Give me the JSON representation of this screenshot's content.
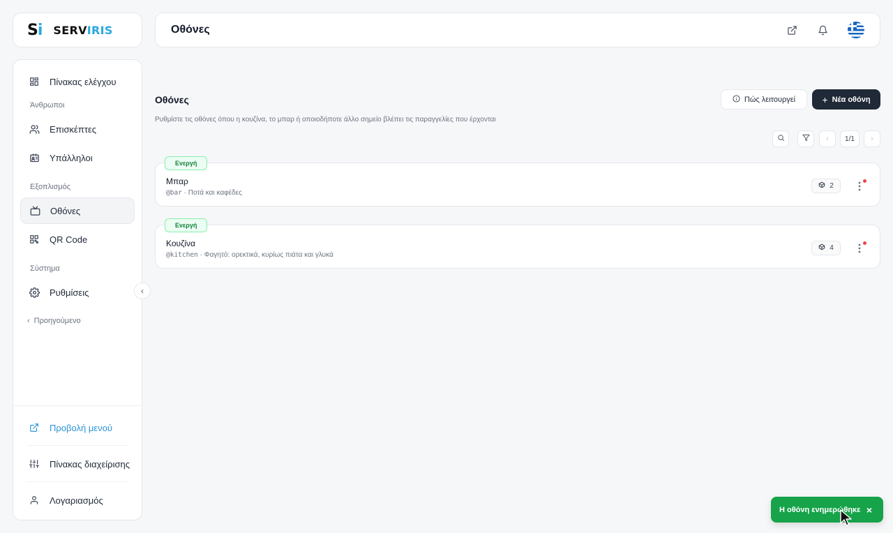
{
  "brand": {
    "mark_s": "S",
    "mark_i": "i",
    "name_a": "SERV",
    "name_b": "IRIS"
  },
  "header": {
    "title": "Οθόνες"
  },
  "sidebar": {
    "dashboard": "Πίνακας ελέγχου",
    "people_section": "Άνθρωποι",
    "guests": "Επισκέπτες",
    "employees": "Υπάλληλοι",
    "equipment_section": "Εξοπλισμός",
    "screens": "Οθόνες",
    "qr": "QR Code",
    "system_section": "Σύστημα",
    "settings": "Ρυθμίσεις",
    "back": "Προηγούμενο",
    "view_menu": "Προβολή μενού",
    "admin_panel": "Πίνακας διαχείρισης",
    "account": "Λογαριασμός"
  },
  "main": {
    "title": "Οθόνες",
    "description": "Ρυθμίστε τις οθόνες όπου η κουζίνα, το μπαρ ή οποιοδήποτε άλλο σημείο βλέπει τις παραγγελίες που έρχονται",
    "how_button": "Πώς λειτουργεί",
    "new_button": "Νέα οθόνη",
    "pager": "1/1"
  },
  "screens": [
    {
      "status": "Ενεργή",
      "name": "Μπαρ",
      "code": "@bar",
      "description": "· Ποτά και καφέδες",
      "count": "2"
    },
    {
      "status": "Ενεργή",
      "name": "Κουζίνα",
      "code": "@kitchen",
      "description": "· Φαγητό: ορεκτικά, κυρίως πιάτα και γλυκά",
      "count": "4"
    }
  ],
  "toast": {
    "message": "Η οθόνη ενημερώθηκε",
    "close": "×"
  },
  "colors": {
    "accent": "#2aa7df",
    "primary_button": "#1f2937",
    "success": "#16a34a",
    "status_bg": "#ecfdf3",
    "notification_dot": "#ef4444"
  },
  "icons": [
    "external-link-icon",
    "bell-icon",
    "greek-flag-icon",
    "grid-icon",
    "users-icon",
    "id-card-icon",
    "monitor-icon",
    "qr-icon",
    "gear-icon",
    "chevron-left-icon",
    "sliders-icon",
    "user-icon",
    "info-icon",
    "plus-icon",
    "search-icon",
    "filter-icon",
    "chevron-right-icon",
    "box-icon",
    "more-vertical-icon",
    "close-icon"
  ]
}
